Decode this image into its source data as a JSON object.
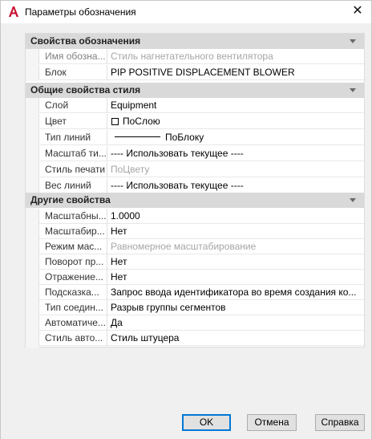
{
  "window": {
    "title": "Параметры обозначения",
    "close_glyph": "✕"
  },
  "sections": {
    "designation": {
      "header": "Свойства обозначения",
      "rows": [
        {
          "name": "Имя обозна...",
          "value": "Стиль нагнетательного вентилятора",
          "disabled": true
        },
        {
          "name": "Блок",
          "value": "PIP POSITIVE DISPLACEMENT BLOWER",
          "disabled": false
        }
      ]
    },
    "general": {
      "header": "Общие свойства стиля",
      "rows": [
        {
          "name": "Слой",
          "value": "Equipment",
          "disabled": false
        },
        {
          "name": "Цвет",
          "value": "ПоСлою",
          "disabled": false
        },
        {
          "name": "Тип линий",
          "value": "ПоБлоку",
          "disabled": false
        },
        {
          "name": "Масштаб ти...",
          "value": "---- Использовать текущее ----",
          "disabled": false
        },
        {
          "name": "Стиль печати",
          "value": "ПоЦвету",
          "disabled": true
        },
        {
          "name": "Вес линий",
          "value": "---- Использовать текущее ----",
          "disabled": false
        }
      ]
    },
    "other": {
      "header": "Другие свойства",
      "rows": [
        {
          "name": "Масштабны...",
          "value": "1.0000",
          "disabled": false
        },
        {
          "name": "Масштабир...",
          "value": "Нет",
          "disabled": false
        },
        {
          "name": "Режим мас...",
          "value": "Равномерное масштабирование",
          "disabled": true
        },
        {
          "name": "Поворот пр...",
          "value": "Нет",
          "disabled": false
        },
        {
          "name": "Отражение...",
          "value": "Нет",
          "disabled": false
        },
        {
          "name": "Подсказка...",
          "value": "Запрос ввода идентификатора во время создания ко...",
          "disabled": false
        },
        {
          "name": "Тип соедин...",
          "value": "Разрыв группы сегментов",
          "disabled": false
        },
        {
          "name": "Автоматиче...",
          "value": "Да",
          "disabled": false
        },
        {
          "name": "Стиль авто...",
          "value": "Стиль штуцера",
          "disabled": false
        }
      ]
    }
  },
  "buttons": {
    "ok": "OK",
    "cancel": "Отмена",
    "help": "Справка"
  },
  "colors": {
    "section_header_bg": "#d9d9d9",
    "client_bg": "#f0f0f0",
    "disabled_text": "#a6a6a6",
    "accent": "#0078d7",
    "app_icon": "#c8102e"
  }
}
